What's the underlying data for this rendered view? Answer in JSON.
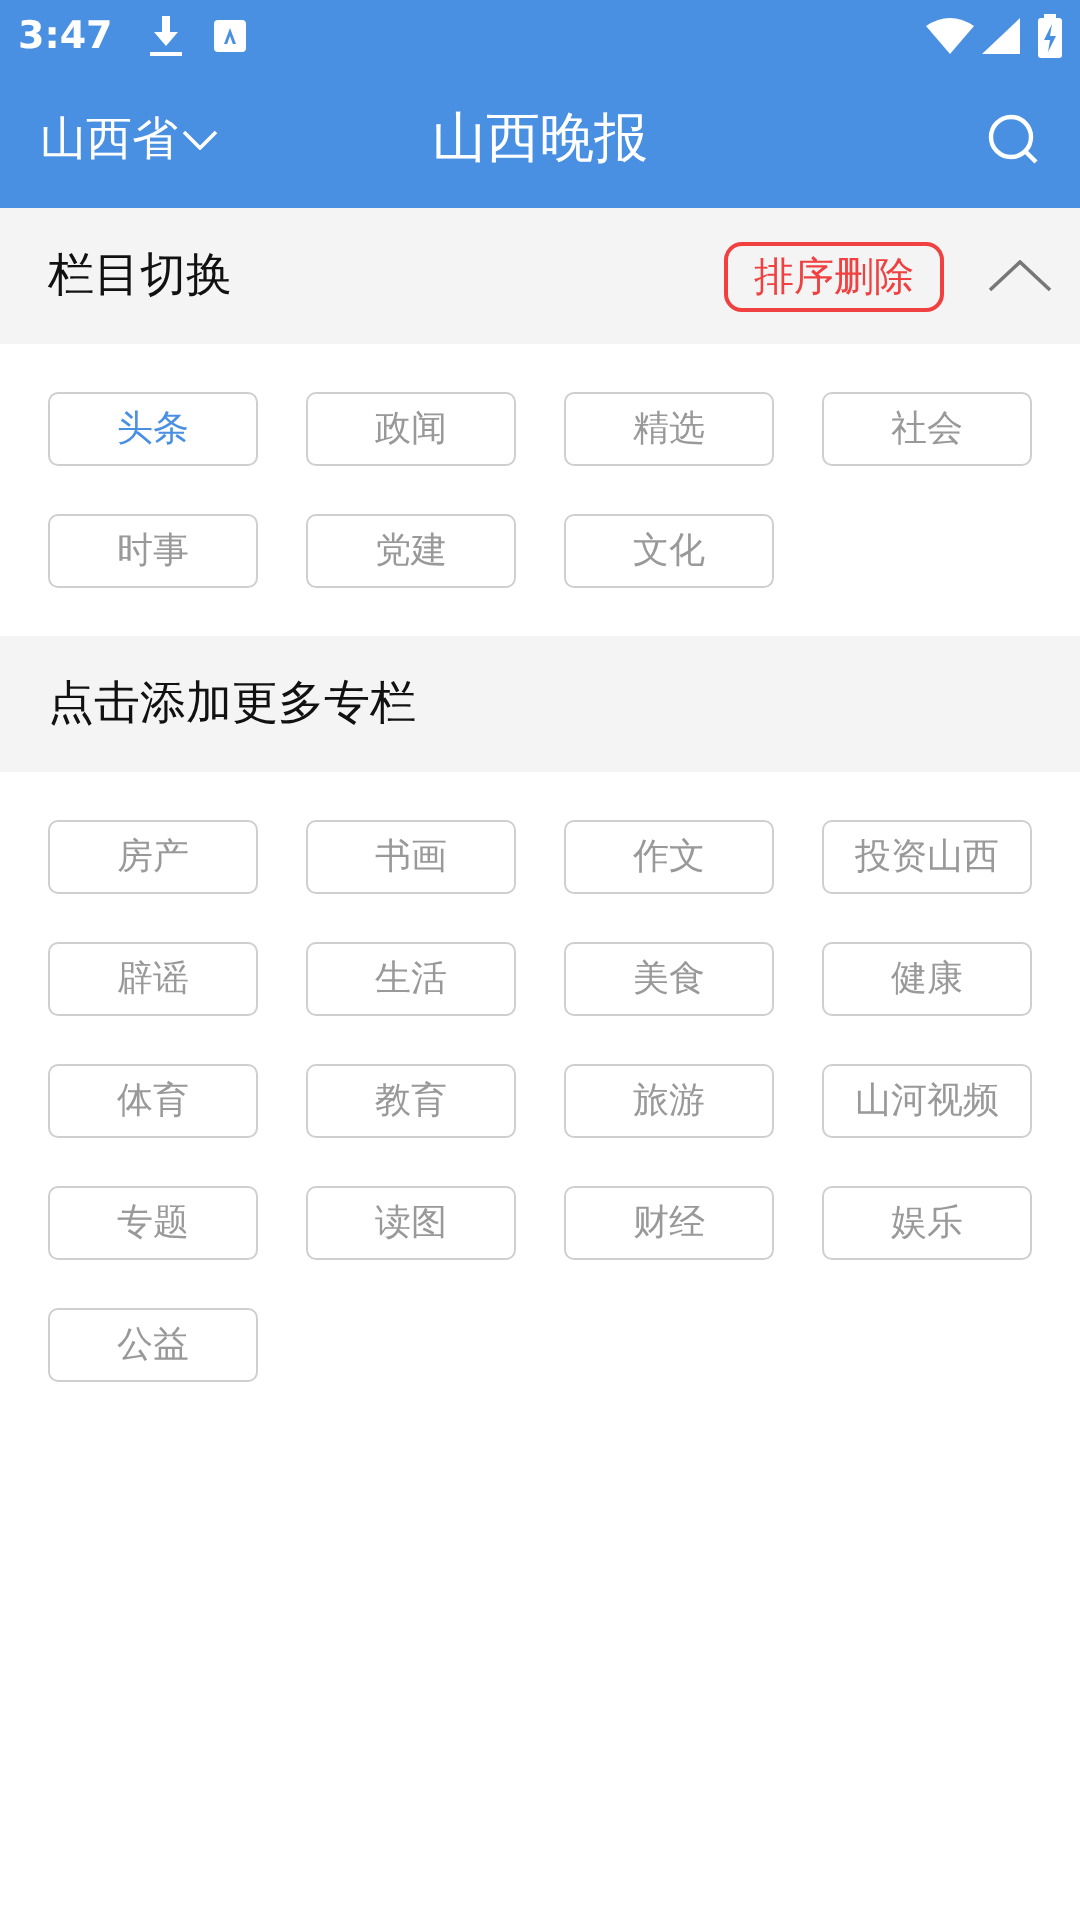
{
  "status_bar": {
    "time": "3:47"
  },
  "header": {
    "province": "山西省",
    "title": "山西晚报"
  },
  "my_channels": {
    "title": "栏目切换",
    "edit_button": "排序删除",
    "expanded": true,
    "items": [
      {
        "label": "头条",
        "selected": true
      },
      {
        "label": "政闻",
        "selected": false
      },
      {
        "label": "精选",
        "selected": false
      },
      {
        "label": "社会",
        "selected": false
      },
      {
        "label": "时事",
        "selected": false
      },
      {
        "label": "党建",
        "selected": false
      },
      {
        "label": "文化",
        "selected": false
      }
    ]
  },
  "more_channels": {
    "title": "点击添加更多专栏",
    "items": [
      "房产",
      "书画",
      "作文",
      "投资山西",
      "辟谣",
      "生活",
      "美食",
      "健康",
      "体育",
      "教育",
      "旅游",
      "山河视频",
      "专题",
      "读图",
      "财经",
      "娱乐",
      "公益"
    ]
  }
}
